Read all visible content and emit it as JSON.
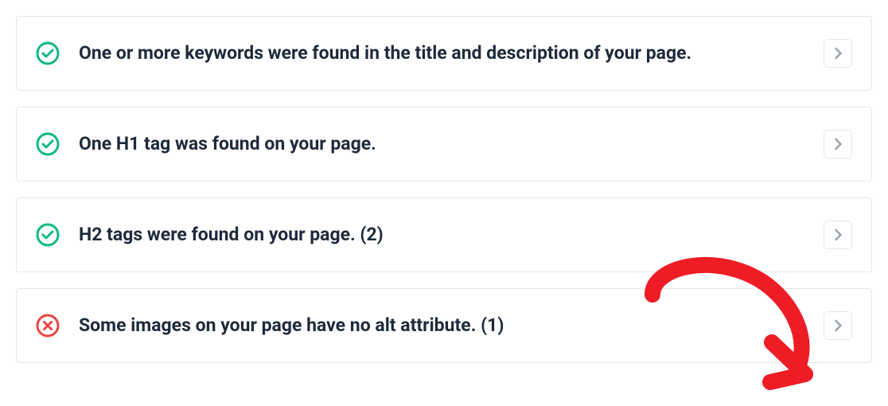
{
  "items": [
    {
      "status": "success",
      "text": "One or more keywords were found in the title and description of your page."
    },
    {
      "status": "success",
      "text": "One H1 tag was found on your page."
    },
    {
      "status": "success",
      "text": "H2 tags were found on your page. (2)"
    },
    {
      "status": "error",
      "text": "Some images on your page have no alt attribute. (1)"
    }
  ],
  "colors": {
    "success": "#10b981",
    "error": "#ef4444",
    "annotation": "#ee1c25"
  }
}
